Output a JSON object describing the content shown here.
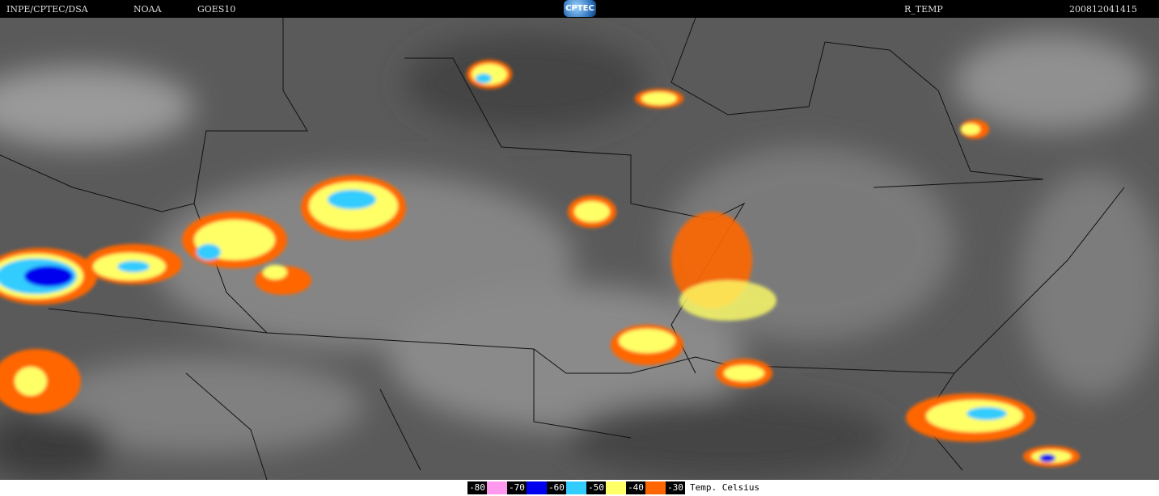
{
  "header": {
    "source": "INPE/CPTEC/DSA",
    "agency": "NOAA",
    "satellite": "GOES10",
    "logo": "CPTEC",
    "product": "R_TEMP",
    "timestamp": "200812041415"
  },
  "legend": {
    "unit": "Temp. Celsius",
    "entries": [
      {
        "label": "-80",
        "color": "#ff99ee"
      },
      {
        "label": "-70",
        "color": "#0000ee"
      },
      {
        "label": "-60",
        "color": "#33ccff"
      },
      {
        "label": "-50",
        "color": "#ffff66"
      },
      {
        "label": "-40",
        "color": "#ff6600"
      },
      {
        "label": "-30",
        "color": null
      }
    ]
  }
}
